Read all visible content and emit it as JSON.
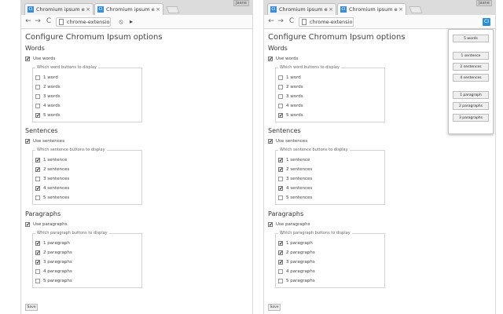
{
  "windows": [
    {
      "tabs": [
        {
          "label": "Chromium ipsum extensio",
          "close": "×",
          "icon": "CI"
        },
        {
          "label": "Chromium ipsum extens",
          "close": "×",
          "icon": "CI"
        }
      ],
      "window_button": "Jaane",
      "address": "chrome-extensio",
      "popup_visible": false
    },
    {
      "tabs": [
        {
          "label": "Chromium ipsum extensio",
          "close": "×",
          "icon": "CI"
        },
        {
          "label": "Chromium ipsum extens",
          "close": "×",
          "icon": "CI"
        }
      ],
      "window_button": "Jaane",
      "address": "chrome-extensio",
      "popup_visible": true
    }
  ],
  "icons": {
    "back": "←",
    "forward": "→",
    "reload": "C",
    "block": "⦸",
    "cursor": "▸",
    "extension": "CI",
    "check": "✔"
  },
  "options": {
    "title": "Configure Chromum Ipsum options",
    "words": {
      "heading": "Words",
      "use_label": "Use words",
      "use_checked": true,
      "legend": "Which word buttons to display",
      "items": [
        {
          "label": "1 word",
          "checked": false
        },
        {
          "label": "2 words",
          "checked": false
        },
        {
          "label": "3 words",
          "checked": false
        },
        {
          "label": "4 words",
          "checked": false
        },
        {
          "label": "5 words",
          "checked": true
        }
      ]
    },
    "sentences": {
      "heading": "Sentences",
      "use_label": "Use sentences",
      "use_checked": true,
      "legend": "Which sentence buttons to display",
      "items": [
        {
          "label": "1 sentence",
          "checked": true
        },
        {
          "label": "2 sentences",
          "checked": true
        },
        {
          "label": "3 sentences",
          "checked": false
        },
        {
          "label": "4 sentences",
          "checked": true
        },
        {
          "label": "5 sentences",
          "checked": false
        }
      ]
    },
    "paragraphs": {
      "heading": "Paragraphs",
      "use_label": "Use paragraphs",
      "use_checked": true,
      "legend": "Which paragraph buttons to display",
      "items": [
        {
          "label": "1 paragraph",
          "checked": true
        },
        {
          "label": "2 paragraphs",
          "checked": true
        },
        {
          "label": "3 paragraphs",
          "checked": true
        },
        {
          "label": "4 paragraphs",
          "checked": false
        },
        {
          "label": "5 paragraphs",
          "checked": false
        }
      ]
    },
    "save_label": "Save"
  },
  "popup": {
    "buttons": [
      "5 words",
      "1 sentence",
      "2 sentences",
      "4 sentences",
      "1 paragraph",
      "2 paragraphs",
      "3 paragraphs"
    ]
  },
  "colors": {
    "accent": "#2b8fd6"
  }
}
